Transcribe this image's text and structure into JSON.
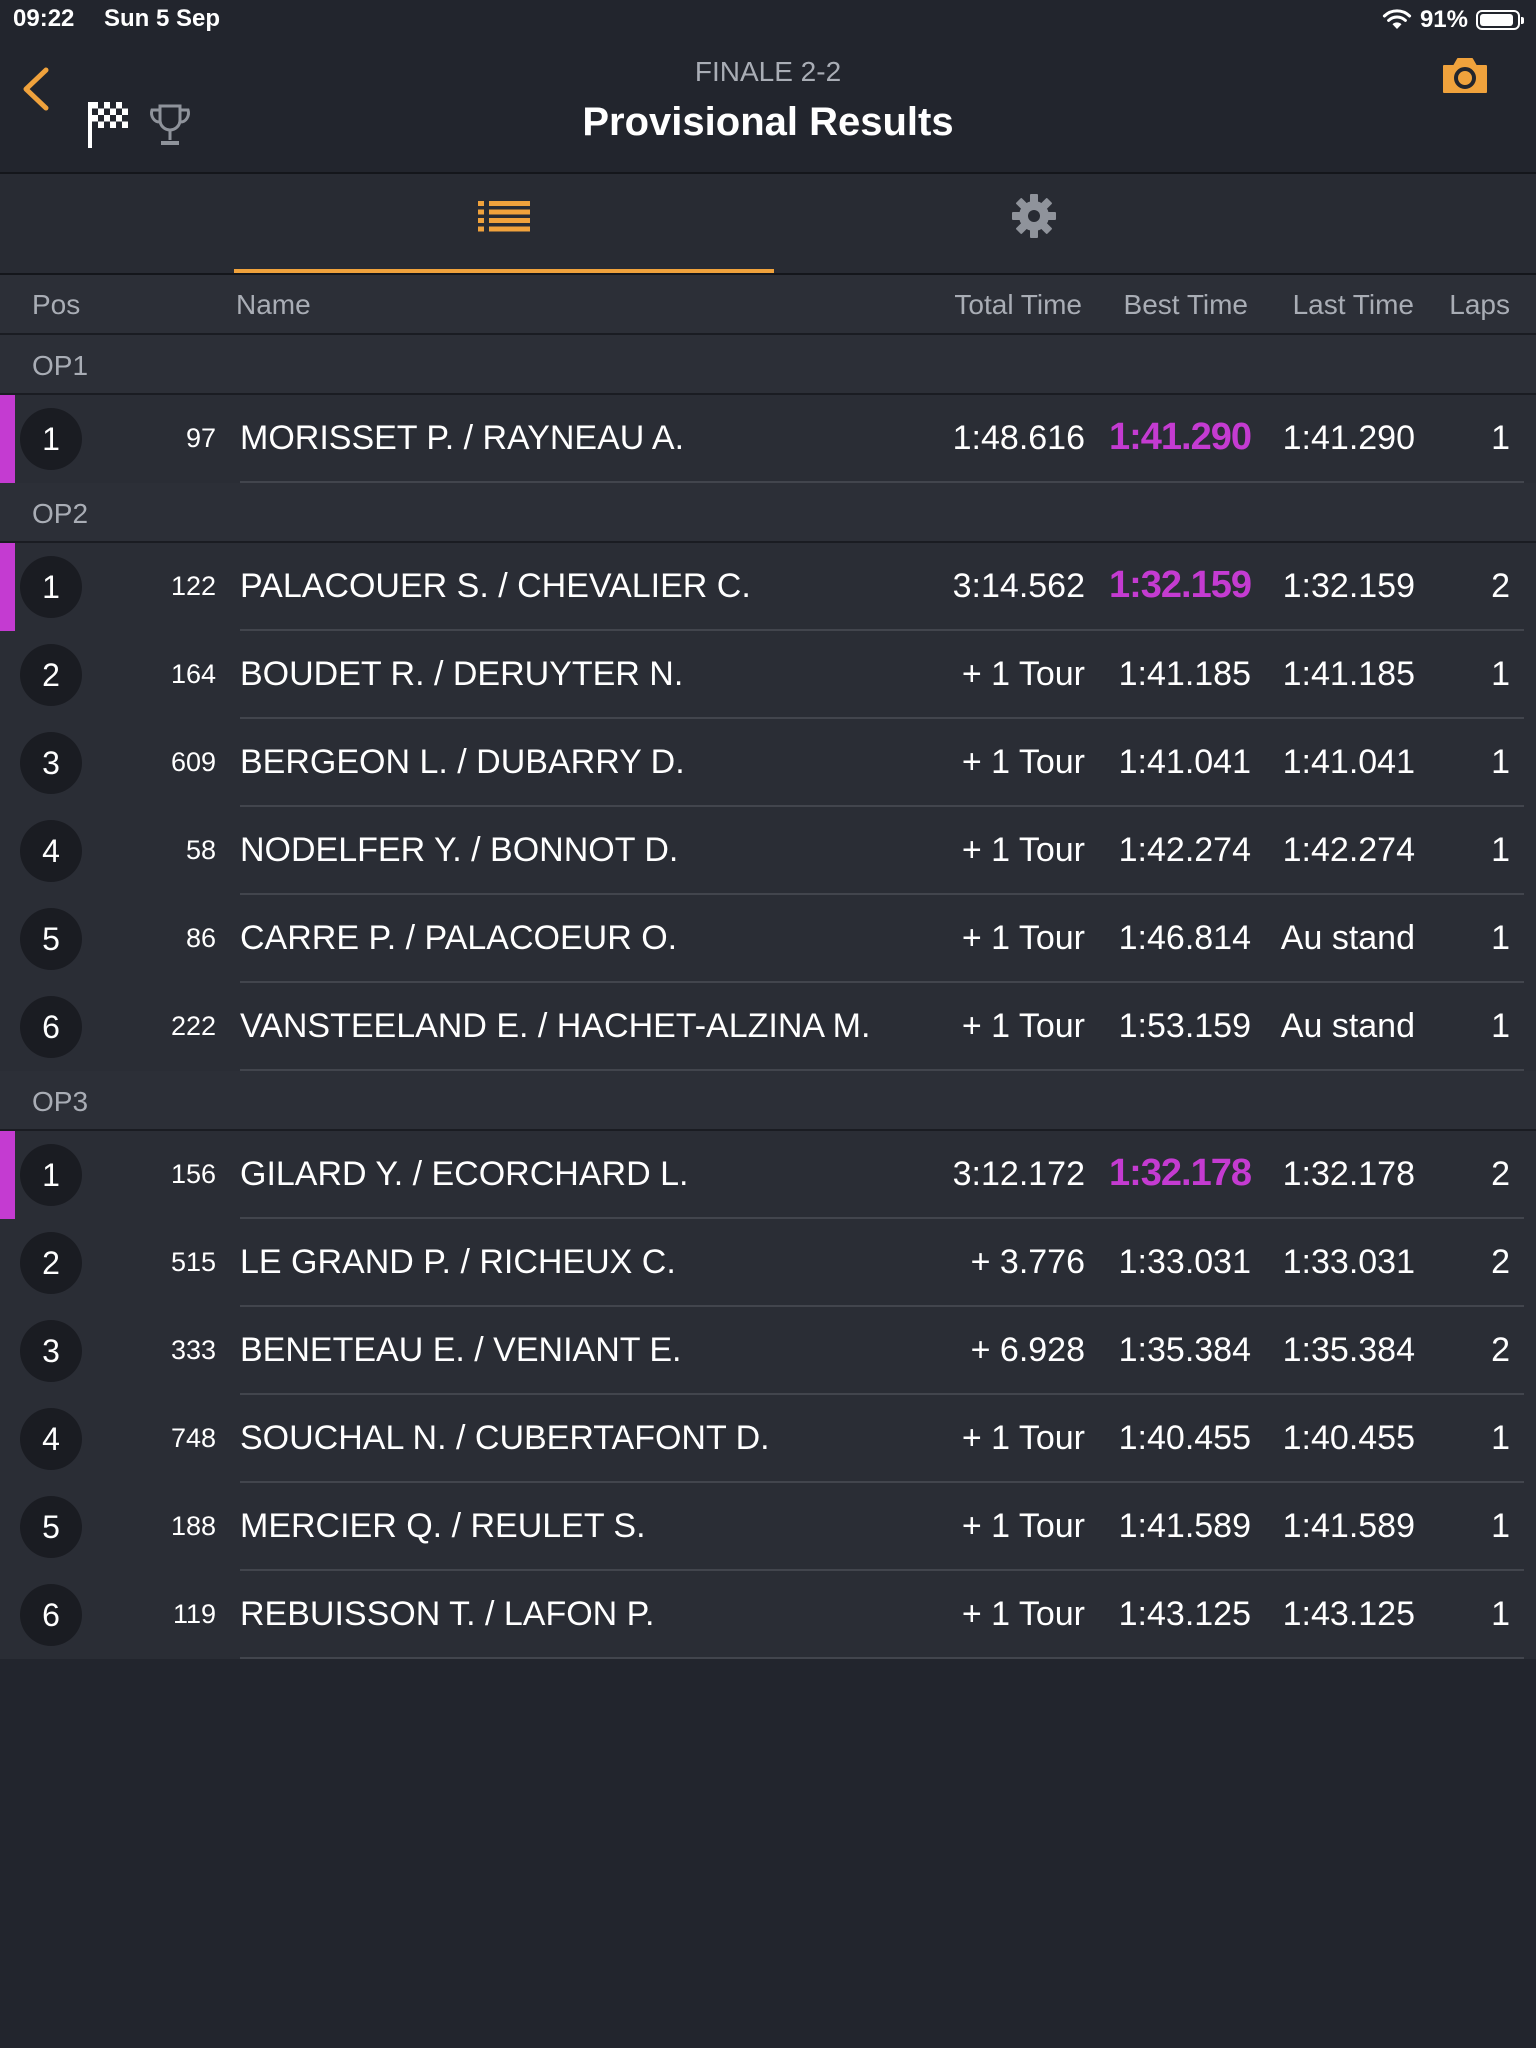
{
  "status_bar": {
    "time": "09:22",
    "date": "Sun 5 Sep",
    "battery_pct_text": "91%",
    "battery_level": 0.91
  },
  "header": {
    "subtitle": "FINALE 2-2",
    "title": "Provisional Results",
    "back_icon": "chevron-left-icon",
    "camera_icon": "camera-icon",
    "flag_icon": "checkered-flag-icon",
    "trophy_icon": "trophy-icon"
  },
  "tabs": [
    {
      "name": "results-list",
      "icon": "list-icon",
      "active": true
    },
    {
      "name": "settings",
      "icon": "gear-icon",
      "active": false
    }
  ],
  "columns": {
    "pos": "Pos",
    "name": "Name",
    "total_time": "Total Time",
    "best_time": "Best Time",
    "last_time": "Last Time",
    "laps": "Laps"
  },
  "colors": {
    "accent": "#f0a23c",
    "fastest": "#c43bd1",
    "background": "#22252d"
  },
  "groups": [
    {
      "label": "OP1",
      "rows": [
        {
          "pos": "1",
          "kart": "97",
          "name": "MORISSET P. / RAYNEAU A.",
          "total": "1:48.616",
          "best": "1:41.290",
          "last": "1:41.290",
          "laps": "1",
          "fastest": true
        }
      ]
    },
    {
      "label": "OP2",
      "rows": [
        {
          "pos": "1",
          "kart": "122",
          "name": "PALACOUER S. / CHEVALIER C.",
          "total": "3:14.562",
          "best": "1:32.159",
          "last": "1:32.159",
          "laps": "2",
          "fastest": true
        },
        {
          "pos": "2",
          "kart": "164",
          "name": "BOUDET R. / DERUYTER N.",
          "total": "+ 1 Tour",
          "best": "1:41.185",
          "last": "1:41.185",
          "laps": "1",
          "fastest": false
        },
        {
          "pos": "3",
          "kart": "609",
          "name": "BERGEON L. / DUBARRY D.",
          "total": "+ 1 Tour",
          "best": "1:41.041",
          "last": "1:41.041",
          "laps": "1",
          "fastest": false
        },
        {
          "pos": "4",
          "kart": "58",
          "name": "NODELFER Y. / BONNOT D.",
          "total": "+ 1 Tour",
          "best": "1:42.274",
          "last": "1:42.274",
          "laps": "1",
          "fastest": false
        },
        {
          "pos": "5",
          "kart": "86",
          "name": "CARRE P. / PALACOEUR O.",
          "total": "+ 1 Tour",
          "best": "1:46.814",
          "last": "Au stand",
          "laps": "1",
          "fastest": false
        },
        {
          "pos": "6",
          "kart": "222",
          "name": "VANSTEELAND E. / HACHET-ALZINA M.",
          "total": "+ 1 Tour",
          "best": "1:53.159",
          "last": "Au stand",
          "laps": "1",
          "fastest": false
        }
      ]
    },
    {
      "label": "OP3",
      "rows": [
        {
          "pos": "1",
          "kart": "156",
          "name": "GILARD Y. / ECORCHARD L.",
          "total": "3:12.172",
          "best": "1:32.178",
          "last": "1:32.178",
          "laps": "2",
          "fastest": true
        },
        {
          "pos": "2",
          "kart": "515",
          "name": "LE GRAND P. / RICHEUX C.",
          "total": "+ 3.776",
          "best": "1:33.031",
          "last": "1:33.031",
          "laps": "2",
          "fastest": false
        },
        {
          "pos": "3",
          "kart": "333",
          "name": "BENETEAU E. / VENIANT E.",
          "total": "+ 6.928",
          "best": "1:35.384",
          "last": "1:35.384",
          "laps": "2",
          "fastest": false
        },
        {
          "pos": "4",
          "kart": "748",
          "name": "SOUCHAL N. / CUBERTAFONT D.",
          "total": "+ 1 Tour",
          "best": "1:40.455",
          "last": "1:40.455",
          "laps": "1",
          "fastest": false
        },
        {
          "pos": "5",
          "kart": "188",
          "name": "MERCIER Q. / REULET S.",
          "total": "+ 1 Tour",
          "best": "1:41.589",
          "last": "1:41.589",
          "laps": "1",
          "fastest": false
        },
        {
          "pos": "6",
          "kart": "119",
          "name": "REBUISSON T. / LAFON P.",
          "total": "+ 1 Tour",
          "best": "1:43.125",
          "last": "1:43.125",
          "laps": "1",
          "fastest": false
        }
      ]
    }
  ]
}
